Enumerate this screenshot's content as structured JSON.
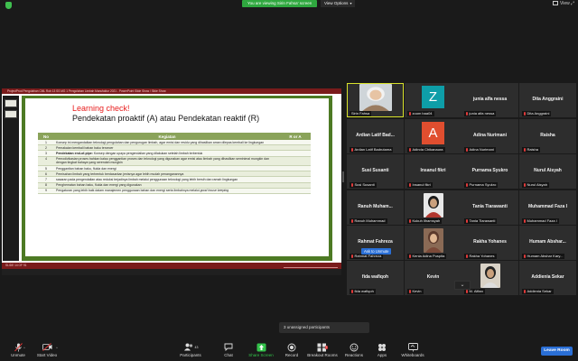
{
  "top": {
    "banner": "You are viewing Sirin Fahsa' screen",
    "view_options": "View Options",
    "view_label": "View"
  },
  "share": {
    "title_bar": "ProjectProd Pengolahan CML Rob 13 SS MG 1 Pengolahan Limbah Manufaktur 2021 - PowerPoint Slide Show / Slide Show",
    "status_left": "SLIDE 14 OF 91",
    "slide": {
      "title": "Learning check!",
      "subtitle": "Pendekatan proaktif  (A) atau Pendekatan reaktif (R)",
      "headers": [
        "No",
        "Kegiatan",
        "R or A"
      ],
      "rows": [
        {
          "no": "1",
          "text": "Konsep ini mengandalkan teknologi pengolahan dan  pengurugan limbah, agar emisi dan residu yang dihasilkan  aman dilepas kembali ke lingkungan",
          "bold": "",
          "ra": ""
        },
        {
          "no": "2",
          "text": "Pemakaian kembali bahan baku tercecer",
          "bold": "",
          "ra": ""
        },
        {
          "no": "3",
          "text": "  Konsep  dengan upaya pengendalian yang dilakukan setelah  limbah terbentuk",
          "bold": "Pendekatan end-of-pipe:",
          "ra": ""
        },
        {
          "no": "4",
          "text": "Pemodivikasian proses bahkan kalau penggantian  proses dan teknologi yang digunakan agar emisi  atau limbah yang dihasilkan seminimal mungkin  dan dengan tingkat bahaya yang serendah  mungkin",
          "bold": "",
          "ra": ""
        },
        {
          "no": "5",
          "text": "Penggantian bahan baku, fluida dan energi",
          "bold": "",
          "ra": ""
        },
        {
          "no": "6",
          "text": "Pemisahan limbah yang terbentuk berdasarkan  jenisnya agar lebih mudah penanganannya",
          "bold": "",
          "ra": ""
        },
        {
          "no": "7",
          "text": "sasaran pada pengendalian  atau  reduksi terjadinya limbah melalui penggunaan  teknologi yang lebih bersih dan ramah lingkungan",
          "bold": "",
          "ra": ""
        },
        {
          "no": "8",
          "text": "Penghematan bahan baku, fluida dan energi yang  digunakan",
          "bold": "",
          "ra": ""
        },
        {
          "no": "9",
          "text": "Pengaturan yang lebih baik dalam manajemen  penggunaan bahan dan energi serta limbahnya melalui ",
          "bold": "",
          "italic": "good house keeping",
          "ra": ""
        }
      ]
    }
  },
  "gallery": [
    {
      "id": "sirin",
      "name": "",
      "caption": "Sirin Fahsa",
      "muted": false,
      "kind": "photo",
      "active": true
    },
    {
      "id": "zoom",
      "name": "",
      "caption": "zoom baa04",
      "muted": true,
      "kind": "letter",
      "letter": "Z",
      "color": "#0e9ea8"
    },
    {
      "id": "junia",
      "name": "junia alfa nessa",
      "caption": "junia alfa nessa",
      "muted": true,
      "kind": "name"
    },
    {
      "id": "dita",
      "name": "Dita Anggraini",
      "caption": "Dita Anggraini",
      "muted": true,
      "kind": "name"
    },
    {
      "id": "ardian",
      "name": "Ardian Latif Bad...",
      "caption": "Ardian Latif Badrutama",
      "muted": true,
      "kind": "name"
    },
    {
      "id": "adinda",
      "name": "",
      "caption": "Adinda Chikanaura",
      "muted": true,
      "kind": "letter",
      "letter": "A",
      "color": "#e04e2f"
    },
    {
      "id": "adina",
      "name": "Adina Nurimani",
      "caption": "Adina Nurimani",
      "muted": true,
      "kind": "name"
    },
    {
      "id": "raisha",
      "name": "Raisha",
      "caption": "Raisha",
      "muted": true,
      "kind": "name"
    },
    {
      "id": "susi",
      "name": "Susi Susanti",
      "caption": "Susi Susanti",
      "muted": true,
      "kind": "name"
    },
    {
      "id": "insanul",
      "name": "Insanul fikri",
      "caption": "Insanul fikri",
      "muted": true,
      "kind": "name"
    },
    {
      "id": "purnama",
      "name": "Purnama Syukro",
      "caption": "Purnama Syukro",
      "muted": true,
      "kind": "name"
    },
    {
      "id": "nurul",
      "name": "Nurul Aisyah",
      "caption": "Nurul Aisyah",
      "muted": true,
      "kind": "name"
    },
    {
      "id": "ranuh",
      "name": "Ranuh  Muham...",
      "caption": "Ranuh Muhammad",
      "muted": true,
      "kind": "name"
    },
    {
      "id": "kukuh",
      "name": "",
      "caption": "Kukuh Ilhamsyah",
      "muted": true,
      "kind": "photo"
    },
    {
      "id": "tania",
      "name": "Tania Tiarawanti",
      "caption": "Tania Tiarawanti",
      "muted": true,
      "kind": "name"
    },
    {
      "id": "mfaza",
      "name": "Muhammad Faza I",
      "caption": "Muhammad Faza I",
      "muted": true,
      "kind": "name"
    },
    {
      "id": "rahmat",
      "name": "Rahmat Fahreza",
      "caption": "Rahmat Fahreza",
      "muted": true,
      "kind": "name"
    },
    {
      "id": "kenia",
      "name": "",
      "caption": "Kenia Adina Puspita",
      "muted": true,
      "kind": "photo"
    },
    {
      "id": "rakha",
      "name": "Rakha Yohanes",
      "caption": "Rakha Yohanes",
      "muted": true,
      "kind": "name"
    },
    {
      "id": "humam",
      "name": "Humam  Abshar...",
      "caption": "Humam Abshar Kary...",
      "muted": true,
      "kind": "name"
    },
    {
      "id": "fida",
      "name": "fida wafiqoh",
      "caption": "fida wafiqoh",
      "muted": true,
      "kind": "name"
    },
    {
      "id": "kevin",
      "name": "Kevin",
      "caption": "Kevin",
      "muted": true,
      "kind": "name"
    },
    {
      "id": "malfian",
      "name": "",
      "caption": "M. Alfian",
      "muted": true,
      "kind": "photo"
    },
    {
      "id": "addienia",
      "name": "Addienia Sekar",
      "caption": "Addienia Sekar",
      "muted": true,
      "kind": "name"
    }
  ],
  "ask_unmute": "Ask to Unmute",
  "toast": "3 unassigned participants",
  "toolbar": {
    "unmute": "Unmute",
    "start_video": "Start Video",
    "participants": "Participants",
    "participants_count": "43",
    "chat": "Chat",
    "share_screen": "Share Screen",
    "record": "Record",
    "breakout_rooms": "Breakout Rooms",
    "reactions": "Reactions",
    "apps": "Apps",
    "whiteboards": "Whiteboards",
    "leave": "Leave Room"
  },
  "colors": {
    "accent_green": "#2fa83f",
    "leave_blue": "#2a6fd6",
    "active_outline": "#d8e22b",
    "slide_green": "#4d7a24",
    "slide_title_red": "#e81c1c"
  }
}
